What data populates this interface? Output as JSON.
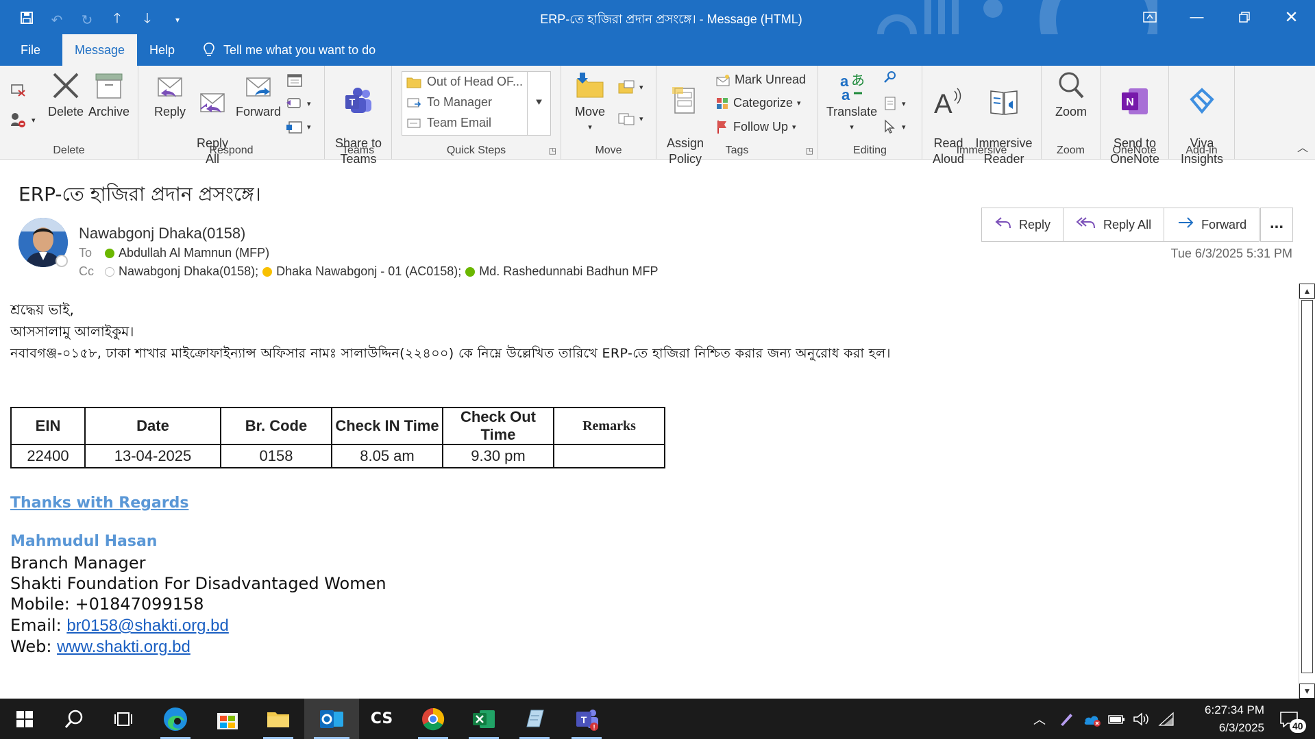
{
  "window": {
    "title": "ERP-তে হাজিরা প্রদান প্রসংঙ্গে।  -  Message (HTML)",
    "controls": [
      "ribbon-display-icon",
      "minimize-icon",
      "restore-icon",
      "close-icon"
    ]
  },
  "quick_access": [
    "save-icon",
    "undo-icon",
    "redo-icon",
    "up-arrow-icon",
    "down-arrow-icon",
    "customize-icon"
  ],
  "menu": {
    "tabs": [
      "File",
      "Message",
      "Help"
    ],
    "active_tab": "Message",
    "tell_me": "Tell me what you want to do"
  },
  "ribbon": {
    "groups": {
      "delete": "Delete",
      "respond": "Respond",
      "teams": "Teams",
      "quick_steps": "Quick Steps",
      "move": "Move",
      "tags": "Tags",
      "editing": "Editing",
      "immersive": "Immersive",
      "zoom": "Zoom",
      "onenote": "OneNote",
      "addin": "Add-in"
    },
    "buttons": {
      "delete": "Delete",
      "archive": "Archive",
      "reply": "Reply",
      "reply_all": "Reply\nAll",
      "forward": "Forward",
      "share_teams": "Share to\nTeams",
      "move": "Move",
      "assign_policy": "Assign\nPolicy",
      "mark_unread": "Mark Unread",
      "categorize": "Categorize",
      "follow_up": "Follow Up",
      "translate": "Translate",
      "read_aloud": "Read\nAloud",
      "immersive_reader": "Immersive\nReader",
      "zoom": "Zoom",
      "send_onenote": "Send to\nOneNote",
      "viva_insights": "Viva\nInsights"
    },
    "quick_steps": [
      "Out of Head OF...",
      "To Manager",
      "Team Email"
    ]
  },
  "message": {
    "subject": "ERP-তে হাজিরা প্রদান প্রসংঙ্গে।",
    "sender": "Nawabgonj Dhaka(0158)",
    "to_label": "To",
    "to": "Abdullah Al Mamnun (MFP)",
    "cc_label": "Cc",
    "cc": [
      "Nawabgonj Dhaka(0158);",
      "Dhaka Nawabgonj - 01 (AC0158);",
      "Md. Rashedunnabi Badhun MFP"
    ],
    "date": "Tue 6/3/2025 5:31 PM",
    "actions": {
      "reply": "Reply",
      "reply_all": "Reply All",
      "forward": "Forward",
      "more": "..."
    }
  },
  "body": {
    "greeting": "শ্রদ্ধেয় ভাই,",
    "salam": "আসসালামু আলাইকুম।",
    "request": "নবাবগঞ্জ-০১৫৮, ঢাকা শাখার মাইক্রোফাইন্যান্স অফিসার নামঃ সালাউদ্দিন(২২৪০০) কে নিম্নে উল্লেখিত তারিখে ERP-তে হাজিরা নিশ্চিত করার জন্য অনুরোধ করা হল।",
    "table": {
      "headers": [
        "EIN",
        "Date",
        "Br. Code",
        "Check IN Time",
        "Check Out Time",
        "Remarks"
      ],
      "rows": [
        [
          "22400",
          "13-04-2025",
          "0158",
          "8.05 am",
          "9.30 pm",
          ""
        ]
      ]
    },
    "signature": {
      "closing": "Thanks with Regards",
      "name": "Mahmudul Hasan",
      "title": "Branch Manager",
      "org": "Shakti Foundation For Disadvantaged Women",
      "mobile_label": "Mobile:",
      "mobile": "+01847099158",
      "email_label": "Email:",
      "email": "br0158@shakti.org.bd",
      "web_label": "Web:",
      "web": "www.shakti.org.bd"
    }
  },
  "taskbar": {
    "apps": [
      "start-icon",
      "search-icon",
      "task-view-icon",
      "edge-icon",
      "store-icon",
      "file-explorer-icon",
      "outlook-icon",
      "cs-app-icon",
      "chrome-icon",
      "excel-icon",
      "notepad-icon",
      "teams-icon"
    ],
    "cs_label": "CS",
    "time": "6:27:34 PM",
    "date": "6/3/2025",
    "notifications": "40"
  },
  "colors": {
    "accent": "#1e6fc4",
    "link": "#1a5fc2",
    "signature_blue": "#5a97d6",
    "presence_green": "#6bb700",
    "presence_yellow": "#f8c000",
    "taskbar": "#1b1b1b"
  }
}
